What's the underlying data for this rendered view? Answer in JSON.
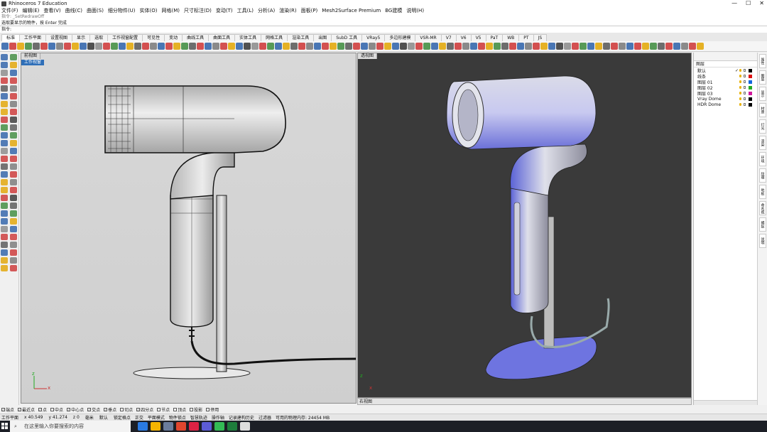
{
  "window": {
    "title": "Rhinoceros 7 Education",
    "min": "—",
    "max": "☐",
    "close": "✕"
  },
  "menu": [
    "文件(F)",
    "编辑(E)",
    "查看(V)",
    "曲线(C)",
    "曲面(S)",
    "细分物件(U)",
    "实体(O)",
    "网格(M)",
    "尺寸标注(D)",
    "变动(T)",
    "工具(L)",
    "分析(A)",
    "渲染(R)",
    "面板(P)",
    "Mesh2Surface Premium",
    "BG建模",
    "说明(H)"
  ],
  "command": {
    "history_1": "指令: _SetRedrawOff",
    "history_2": "选取要显示的物件，按 Enter 完成",
    "prompt": "指令:"
  },
  "tabs": [
    "标准",
    "工作平面",
    "设置视图",
    "显示",
    "选取",
    "工作视窗配置",
    "可见性",
    "变动",
    "曲线工具",
    "曲面工具",
    "实体工具",
    "网格工具",
    "渲染工具",
    "出图",
    "SubD 工具",
    "VRay5",
    "多边形建模",
    "VSR-MR",
    "V7",
    "V6",
    "V5",
    "PaT",
    "WB",
    "PT",
    "JS"
  ],
  "toolbar_colors": [
    "#2a5fa8",
    "#c33",
    "#e2a400",
    "#3b8a3b",
    "#555",
    "#c33",
    "#2a5fa8",
    "#777",
    "#c33",
    "#e2a400",
    "#2a5fa8",
    "#333",
    "#888",
    "#c33",
    "#3b8a3b",
    "#2a5fa8",
    "#e2a400",
    "#555",
    "#c33",
    "#777"
  ],
  "viewports": {
    "left": {
      "title": "前视图",
      "sublabel": "工作视窗",
      "axis_x": "x",
      "axis_z": "z"
    },
    "right": {
      "title": "透视图",
      "axis_x": "x",
      "axis_z": "z"
    }
  },
  "viewport_tabs": {
    "label": "右视图"
  },
  "panel": {
    "title": "图层",
    "layers": [
      {
        "name": "默认",
        "current": "✓",
        "color": "#000000"
      },
      {
        "name": "线条",
        "color": "#d11"
      },
      {
        "name": "图层 01",
        "color": "#1166dd"
      },
      {
        "name": "图层 02",
        "color": "#22aa22"
      },
      {
        "name": "图层 03",
        "color": "#d1189b"
      },
      {
        "name": "Vray Dome",
        "color": "#000000"
      },
      {
        "name": "HDR Dome",
        "color": "#000000"
      }
    ]
  },
  "sidetabs": [
    "属性",
    "图层",
    "显示",
    "材质",
    "灯光",
    "渲染",
    "环境",
    "纹理",
    "地板",
    "命名视图",
    "捕捉",
    "说明"
  ],
  "osnap": [
    {
      "label": "端点",
      "on": true
    },
    {
      "label": "最近点",
      "on": true
    },
    {
      "label": "点",
      "on": true
    },
    {
      "label": "中点",
      "on": false
    },
    {
      "label": "中心点",
      "on": true
    },
    {
      "label": "交点",
      "on": true
    },
    {
      "label": "垂点",
      "on": true
    },
    {
      "label": "切点",
      "on": false
    },
    {
      "label": "四分点",
      "on": true
    },
    {
      "label": "节点",
      "on": false
    },
    {
      "label": "顶点",
      "on": false
    },
    {
      "label": "投影",
      "on": false
    },
    {
      "label": "停用",
      "on": false
    }
  ],
  "status": {
    "cplane": "工作平面",
    "x": "x 40.549",
    "y": "y 41.274",
    "z": "z 0",
    "unit": "毫米",
    "layer": "默认",
    "items": [
      "锁定格点",
      "正交",
      "平面模式",
      "物件锁点",
      "智慧轨迹",
      "操作轴",
      "记录建构历史",
      "过滤器",
      "可用的物理内存: 24454 MB"
    ]
  },
  "taskbar": {
    "search_placeholder": "在这里输入你要搜索的内容",
    "apps": [
      "#2a7be4",
      "#f4b400",
      "#6a7c9c",
      "#e0462f",
      "#dd2244",
      "#5c5cd6",
      "#33bb55",
      "#1e7d3c",
      "#dddddd"
    ]
  }
}
